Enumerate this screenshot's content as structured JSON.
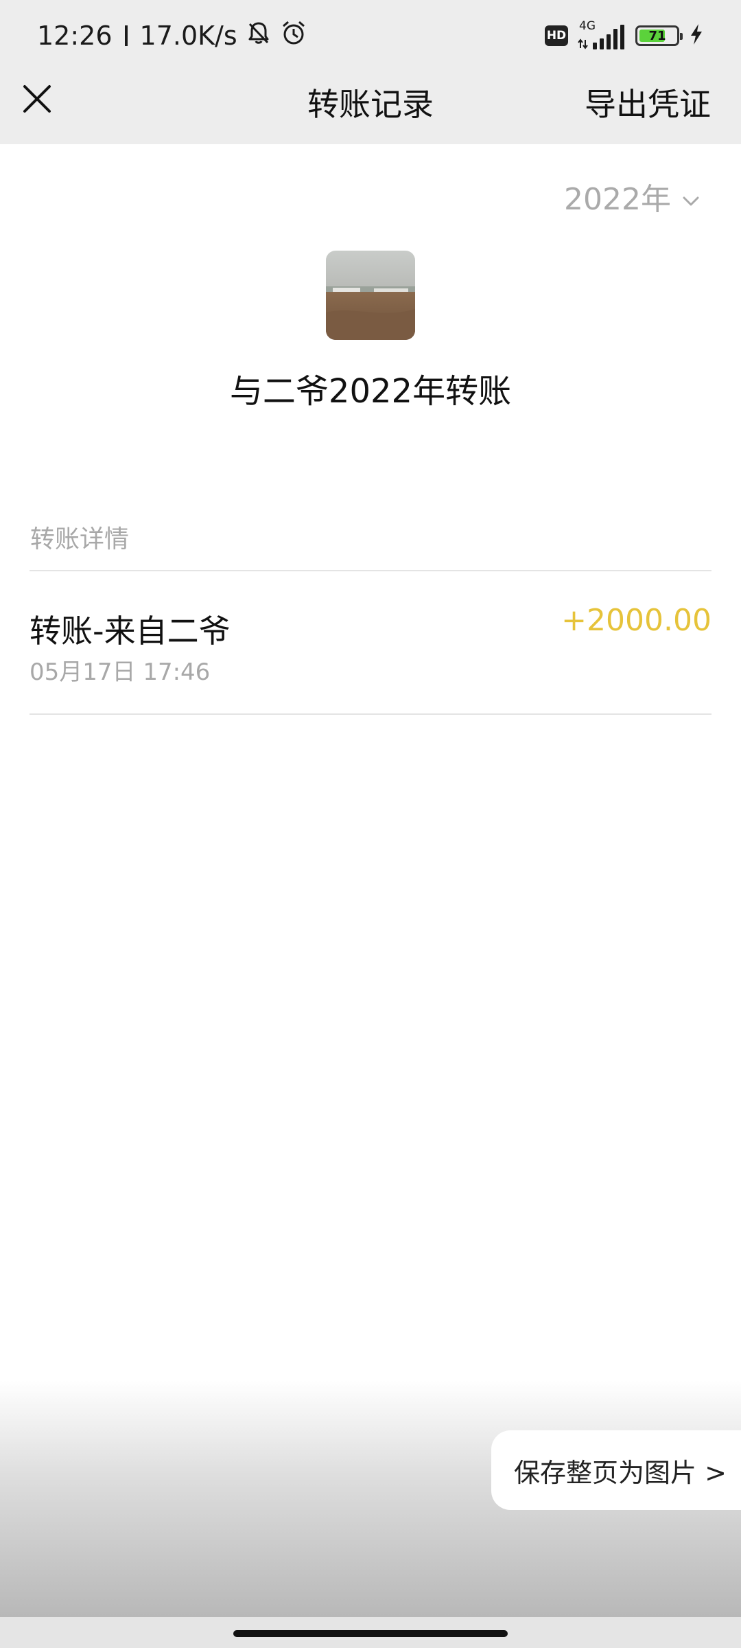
{
  "status_bar": {
    "time": "12:26",
    "net_speed": "17.0K/s",
    "hd_label": "HD",
    "network_type": "4G",
    "battery_level": "71",
    "battery_fraction": 0.71,
    "icons": [
      "bell-off-icon",
      "alarm-icon",
      "signal-icon",
      "battery-icon",
      "charging-icon"
    ]
  },
  "nav": {
    "title": "转账记录",
    "export_label": "导出凭证",
    "close_icon": "close-icon"
  },
  "year_selector": {
    "value": "2022年",
    "icon": "chevron-down-icon"
  },
  "contact": {
    "heading": "与二爷2022年转账"
  },
  "section": {
    "title": "转账详情"
  },
  "transactions": [
    {
      "title": "转账-来自二爷",
      "time": "05月17日 17:46",
      "amount": "+2000.00"
    }
  ],
  "save_button": {
    "label": "保存整页为图片 >"
  },
  "colors": {
    "bar_bg": "#ededed",
    "amount": "#e6c33a",
    "muted_text": "#a8a8a8",
    "battery_fill": "#5bd23b"
  }
}
